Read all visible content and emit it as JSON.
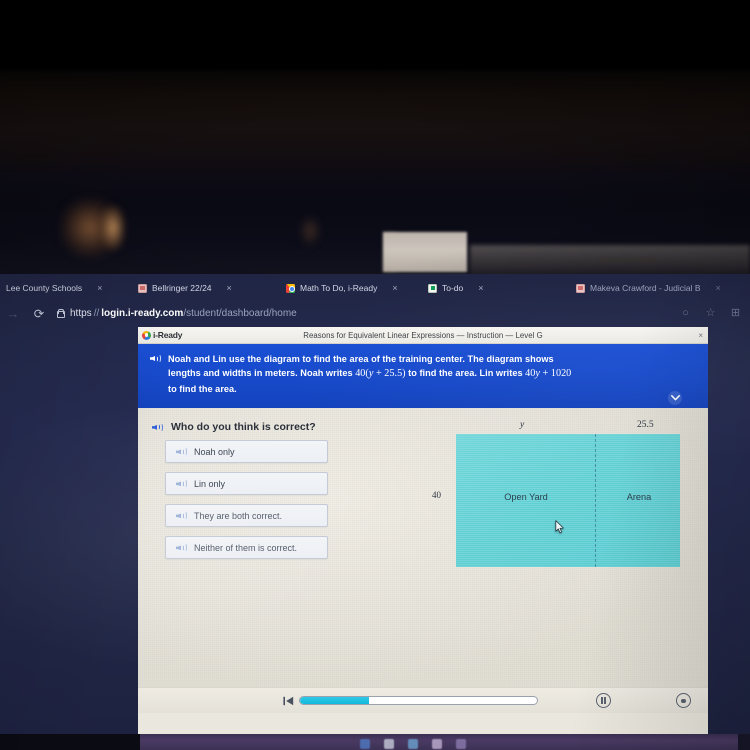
{
  "browser": {
    "tabs": [
      {
        "title": "Lee County Schools",
        "favicon": "none-icon",
        "close": "×"
      },
      {
        "title": "Bellringer 22/24",
        "favicon": "pdf-icon",
        "close": "×"
      },
      {
        "title": "Math To Do, i-Ready",
        "favicon": "chrome-icon",
        "close": "×"
      },
      {
        "title": "To-do",
        "favicon": "docs-icon",
        "close": "×"
      },
      {
        "title": "Makeva Crawford - Judicial B",
        "favicon": "pdf-icon",
        "close": "×"
      }
    ],
    "nav": {
      "forward_icon": "→",
      "reload_icon": "⟳",
      "lock_icon": "lock-icon",
      "url_scheme": "https",
      "url_sep": "//",
      "url_host": "login.i-ready.com",
      "url_path": "/student/dashboard/home"
    },
    "toolbar_icons": [
      "○",
      "☆",
      "⊞"
    ]
  },
  "app": {
    "logo_text": "i-Ready",
    "title": "Reasons for Equivalent Linear Expressions — Instruction — Level G",
    "close_label": "×",
    "banner": {
      "line1": "Noah and Lin use the diagram to find the area of the training center. The diagram shows",
      "line2_a": "lengths and widths in meters. Noah writes ",
      "line2_math1": "40(",
      "line2_math1_var": "y",
      "line2_math1_rest": " + 25.5)",
      "line2_b": " to find the area. Lin writes ",
      "line2_math2_a": "40",
      "line2_math2_var": "y",
      "line2_math2_rest": " + 1020",
      "line3": "to find the area.",
      "speaker_icon": "speaker-icon",
      "expand_icon": "chevron-down-icon"
    },
    "question": {
      "speaker_icon": "speaker-icon",
      "text": "Who do you think is correct?"
    },
    "choices": [
      {
        "label": "Noah only",
        "speaker_icon": "speaker-icon"
      },
      {
        "label": "Lin only",
        "speaker_icon": "speaker-icon"
      },
      {
        "label": "They are both correct.",
        "speaker_icon": "speaker-icon"
      },
      {
        "label": "Neither of them is correct.",
        "speaker_icon": "speaker-icon"
      }
    ],
    "diagram": {
      "top_left_label": "y",
      "top_right_label": "25.5",
      "left_label": "40",
      "zone_left": "Open Yard",
      "zone_right": "Arena",
      "fill_color": "#62d0d4"
    },
    "footer": {
      "start_icon": "skip-to-start-icon",
      "progress_percent": 29,
      "pause_icon": "pause-icon",
      "settings_icon": "settings-icon"
    }
  },
  "colors": {
    "banner_blue": "#1749c9",
    "page_cream": "#e9e6dd",
    "diagram_teal": "#62d0d4",
    "progress_cyan": "#12b9dd",
    "browser_navy": "#242a4d"
  }
}
